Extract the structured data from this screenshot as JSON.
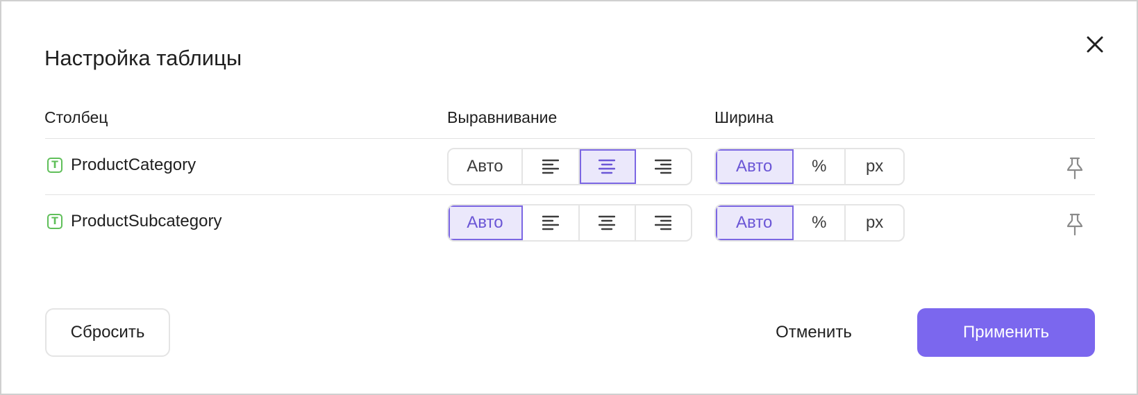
{
  "dialog": {
    "title": "Настройка таблицы"
  },
  "columns_header": {
    "column": "Столбец",
    "alignment": "Выравнивание",
    "width": "Ширина"
  },
  "rows": [
    {
      "type_icon_letter": "T",
      "name": "ProductCategory",
      "alignment_options": [
        "Авто",
        "align-left-icon",
        "align-center-icon",
        "align-right-icon"
      ],
      "alignment_selected": "align-center",
      "width_options": [
        "Авто",
        "%",
        "px"
      ],
      "width_selected": "Авто"
    },
    {
      "type_icon_letter": "T",
      "name": "ProductSubcategory",
      "alignment_options": [
        "Авто",
        "align-left-icon",
        "align-center-icon",
        "align-right-icon"
      ],
      "alignment_selected": "Авто",
      "width_options": [
        "Авто",
        "%",
        "px"
      ],
      "width_selected": "Авто"
    }
  ],
  "footer": {
    "reset_label": "Сбросить",
    "cancel_label": "Отменить",
    "apply_label": "Применить"
  },
  "colors": {
    "accent": "#7b67ee",
    "accent_light": "#ebe8fb",
    "type_icon": "#5fbf59"
  }
}
